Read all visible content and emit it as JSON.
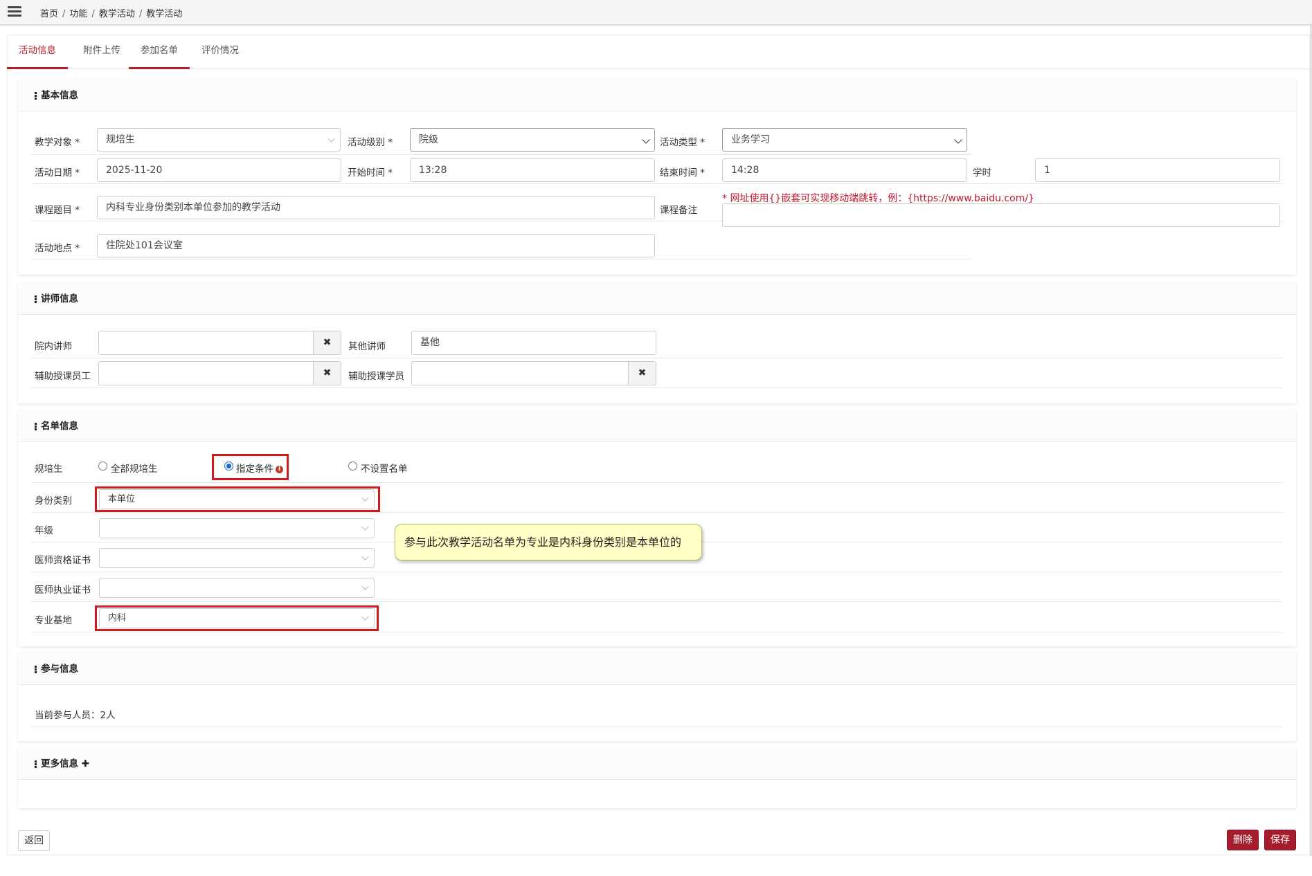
{
  "breadcrumb": [
    "首页",
    "功能",
    "教学活动",
    "教学活动"
  ],
  "tabs": [
    "活动信息",
    "附件上传",
    "参加名单",
    "评价情况"
  ],
  "basic": {
    "title": "基本信息",
    "target_label": "教学对象 *",
    "target_value": "规培生",
    "level_label": "活动级别 *",
    "level_value": "院级",
    "type_label": "活动类型 *",
    "type_value": "业务学习",
    "date_label": "活动日期 *",
    "date_value": "2025-11-20",
    "start_label": "开始时间 *",
    "start_value": "13:28",
    "end_label": "结束时间 *",
    "end_value": "14:28",
    "hours_label": "学时",
    "hours_value": "1",
    "topic_label": "课程题目 *",
    "topic_value": "内科专业身份类别本单位参加的教学活动",
    "remark_label": "课程备注",
    "remark_note": "* 网址使用{}嵌套可实现移动端跳转，例：{https://www.baidu.com/}",
    "remark_value": "",
    "place_label": "活动地点 *",
    "place_value": "住院处101会议室"
  },
  "lecturer": {
    "title": "讲师信息",
    "internal_label": "院内讲师",
    "internal_value": "",
    "other_label": "其他讲师",
    "other_value": "基他",
    "assist_staff_label": "辅助授课员工",
    "assist_staff_value": "",
    "assist_student_label": "辅助授课学员",
    "assist_student_value": ""
  },
  "roster": {
    "title": "名单信息",
    "trainee_label": "规培生",
    "radio_all": "全部规培生",
    "radio_specified": "指定条件",
    "radio_none": "不设置名单",
    "identity_label": "身份类别",
    "identity_value": "本单位",
    "grade_label": "年级",
    "grade_value": "",
    "qualification_label": "医师资格证书",
    "qualification_value": "",
    "license_label": "医师执业证书",
    "license_value": "",
    "base_label": "专业基地",
    "base_value": "内科",
    "tooltip": "参与此次教学活动名单为专业是内科身份类别是本单位的"
  },
  "participation": {
    "title": "参与信息",
    "current_text": "当前参与人员：2人"
  },
  "more": {
    "title": "更多信息",
    "plus": "✚"
  },
  "buttons": {
    "back": "返回",
    "delete": "删除",
    "save": "保存"
  },
  "colors": {
    "accent": "#b71c2c",
    "button_red": "#a51d2d",
    "highlight_border": "#d11a1a",
    "tooltip_bg": "#ffffc6"
  }
}
